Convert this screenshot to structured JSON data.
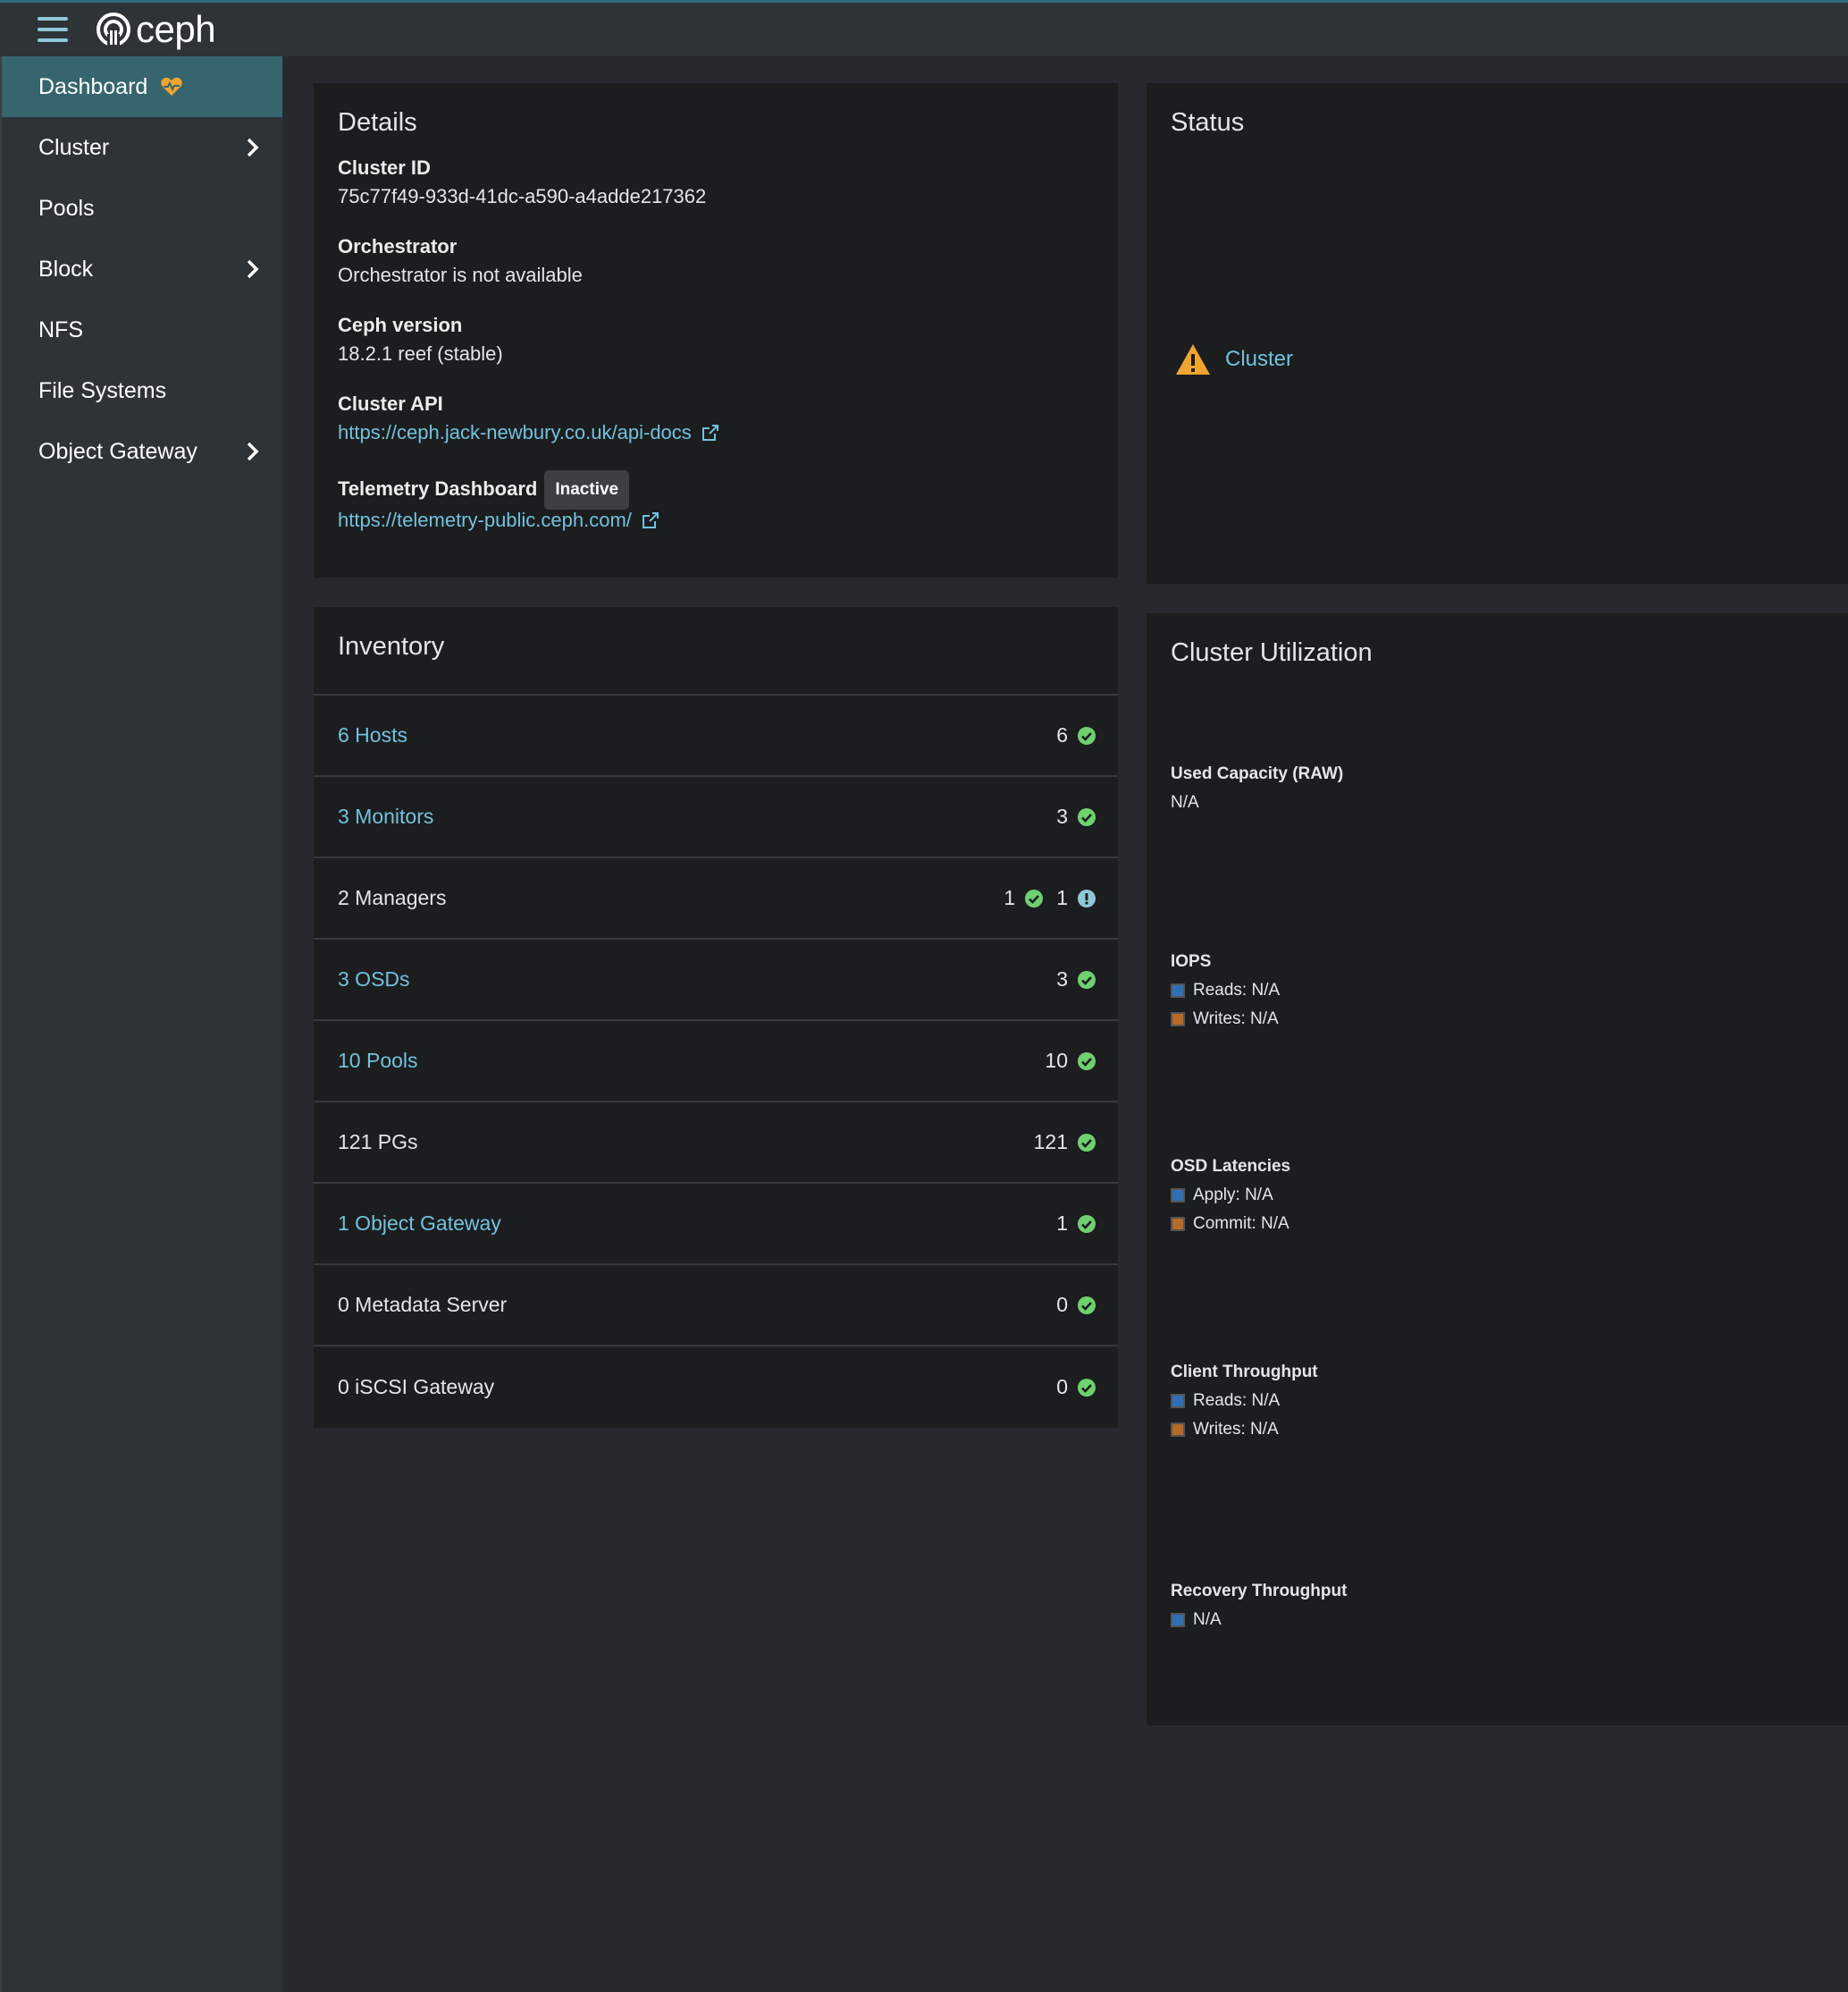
{
  "navbar": {
    "brand": "ceph",
    "menu_icon": "hamburger-icon",
    "logo_icon": "ceph-logo-icon"
  },
  "sidebar": {
    "items": [
      {
        "label": "Dashboard",
        "active": true,
        "icon": "heartbeat-icon"
      },
      {
        "label": "Cluster",
        "has_submenu": true
      },
      {
        "label": "Pools"
      },
      {
        "label": "Block",
        "has_submenu": true
      },
      {
        "label": "NFS"
      },
      {
        "label": "File Systems"
      },
      {
        "label": "Object Gateway",
        "has_submenu": true
      }
    ]
  },
  "details": {
    "title": "Details",
    "cluster_id_label": "Cluster ID",
    "cluster_id": "75c77f49-933d-41dc-a590-a4adde217362",
    "orchestrator_label": "Orchestrator",
    "orchestrator": "Orchestrator is not available",
    "version_label": "Ceph version",
    "version": "18.2.1 reef (stable)",
    "api_label": "Cluster API",
    "api_url": "https://ceph.jack-newbury.co.uk/api-docs",
    "telemetry_label": "Telemetry Dashboard",
    "telemetry_badge": "Inactive",
    "telemetry_url": "https://telemetry-public.ceph.com/"
  },
  "status": {
    "title": "Status",
    "item_label": "Cluster",
    "item_icon": "warning-icon"
  },
  "inventory": {
    "title": "Inventory",
    "rows": [
      {
        "label": "6 Hosts",
        "link": true,
        "counts": [
          {
            "value": "6",
            "state": "ok"
          }
        ]
      },
      {
        "label": "3 Monitors",
        "link": true,
        "counts": [
          {
            "value": "3",
            "state": "ok"
          }
        ]
      },
      {
        "label": "2 Managers",
        "link": false,
        "counts": [
          {
            "value": "1",
            "state": "ok"
          },
          {
            "value": "1",
            "state": "info"
          }
        ]
      },
      {
        "label": "3 OSDs",
        "link": true,
        "counts": [
          {
            "value": "3",
            "state": "ok"
          }
        ]
      },
      {
        "label": "10 Pools",
        "link": true,
        "counts": [
          {
            "value": "10",
            "state": "ok"
          }
        ]
      },
      {
        "label": "121 PGs",
        "link": false,
        "counts": [
          {
            "value": "121",
            "state": "ok"
          }
        ]
      },
      {
        "label": "1 Object Gateway",
        "link": true,
        "counts": [
          {
            "value": "1",
            "state": "ok"
          }
        ]
      },
      {
        "label": "0 Metadata Server",
        "link": false,
        "counts": [
          {
            "value": "0",
            "state": "ok"
          }
        ]
      },
      {
        "label": "0 iSCSI Gateway",
        "link": false,
        "counts": [
          {
            "value": "0",
            "state": "ok"
          }
        ]
      }
    ]
  },
  "utilization": {
    "title": "Cluster Utilization",
    "used_capacity_label": "Used Capacity (RAW)",
    "used_capacity_value": "N/A",
    "iops_label": "IOPS",
    "iops_reads": "Reads: N/A",
    "iops_writes": "Writes: N/A",
    "osd_label": "OSD Latencies",
    "osd_apply": "Apply: N/A",
    "osd_commit": "Commit: N/A",
    "client_label": "Client Throughput",
    "client_reads": "Reads: N/A",
    "client_writes": "Writes: N/A",
    "recovery_label": "Recovery Throughput",
    "recovery_value": "N/A"
  },
  "colors": {
    "accent": "#72c2dd",
    "ok": "#6fd06f",
    "warning": "#f0a531",
    "info": "#8fc8d8",
    "series_blue": "#2f6fb6",
    "series_orange": "#b86a26"
  }
}
